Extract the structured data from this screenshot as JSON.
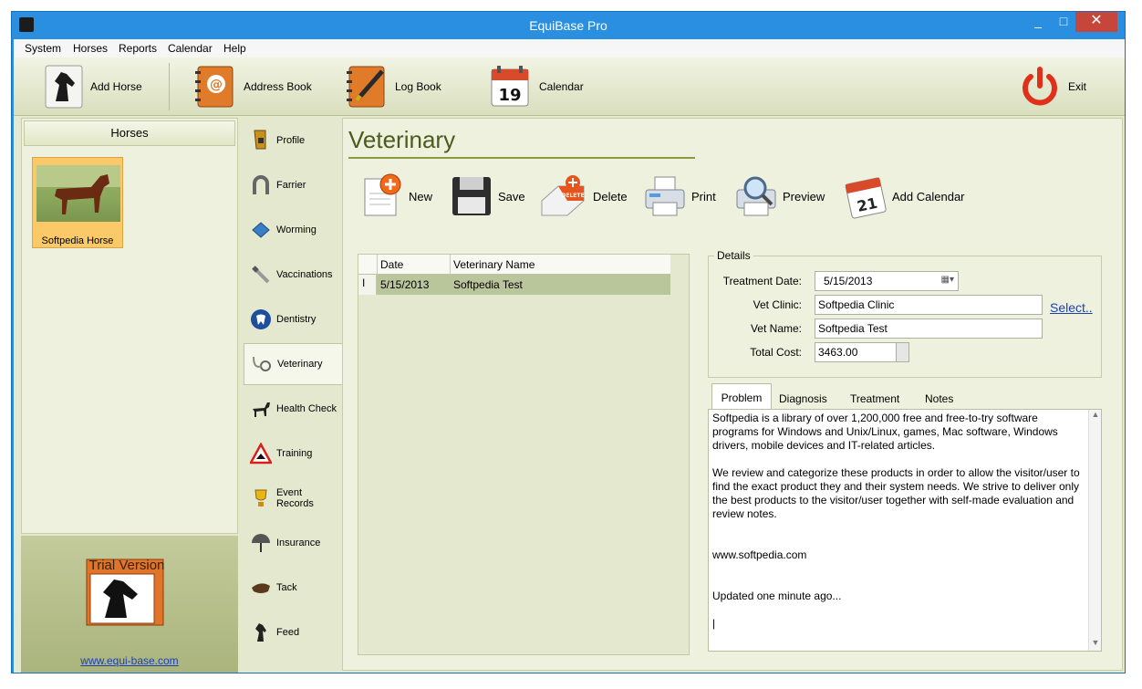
{
  "window": {
    "title": "EquiBase Pro",
    "minimize": "_",
    "maximize": "□",
    "close": "✕"
  },
  "menu": [
    "System",
    "Horses",
    "Reports",
    "Calendar",
    "Help"
  ],
  "toolbar": {
    "add_horse": "Add Horse",
    "address_book": "Address Book",
    "log_book": "Log Book",
    "calendar": "Calendar",
    "calendar_day": "19",
    "exit": "Exit"
  },
  "left_panel": {
    "header": "Horses",
    "horse": {
      "name": "Softpedia Horse"
    },
    "trial_text": "Trial Version",
    "link": "www.equi-base.com"
  },
  "nav": [
    {
      "label": "Profile",
      "icon": "boot-icon"
    },
    {
      "label": "Farrier",
      "icon": "horseshoe-icon"
    },
    {
      "label": "Worming",
      "icon": "worming-icon"
    },
    {
      "label": "Vaccinations",
      "icon": "syringe-icon"
    },
    {
      "label": "Dentistry",
      "icon": "tooth-icon"
    },
    {
      "label": "Veterinary",
      "icon": "stethoscope-icon"
    },
    {
      "label": "Health Check",
      "icon": "horse-icon"
    },
    {
      "label": "Training",
      "icon": "warning-horse-icon"
    },
    {
      "label": "Event Records",
      "icon": "trophy-icon"
    },
    {
      "label": "Insurance",
      "icon": "umbrella-icon"
    },
    {
      "label": "Tack",
      "icon": "saddle-icon"
    },
    {
      "label": "Feed",
      "icon": "horse-feed-icon"
    }
  ],
  "main": {
    "title": "Veterinary",
    "actions": {
      "new": "New",
      "save": "Save",
      "delete": "Delete",
      "delete_badge": "DELETE",
      "print": "Print",
      "preview": "Preview",
      "add_calendar": "Add Calendar",
      "add_calendar_day": "21"
    },
    "grid": {
      "columns": [
        "Date",
        "Veterinary Name"
      ],
      "rows": [
        {
          "date": "5/15/2013",
          "name": "Softpedia Test"
        }
      ],
      "row_marker": "I"
    },
    "details": {
      "legend": "Details",
      "treatment_date_label": "Treatment Date:",
      "treatment_date": "5/15/2013",
      "vet_clinic_label": "Vet Clinic:",
      "vet_clinic": "Softpedia Clinic",
      "select_link": "Select..",
      "vet_name_label": "Vet Name:",
      "vet_name": "Softpedia Test",
      "total_cost_label": "Total Cost:",
      "total_cost": "3463.00"
    },
    "tabs": [
      "Problem",
      "Diagnosis",
      "Treatment",
      "Notes"
    ],
    "problem_text": "Softpedia is a library of over 1,200,000 free and free-to-try software programs for Windows and Unix/Linux, games, Mac software, Windows drivers, mobile devices and IT-related articles.\n\nWe review and categorize these products in order to allow the visitor/user to find the exact product they and their system needs. We strive to deliver only the best products to the visitor/user together with self-made evaluation and review notes.\n\n\nwww.softpedia.com\n\n\nUpdated one minute ago...\n\n|"
  }
}
